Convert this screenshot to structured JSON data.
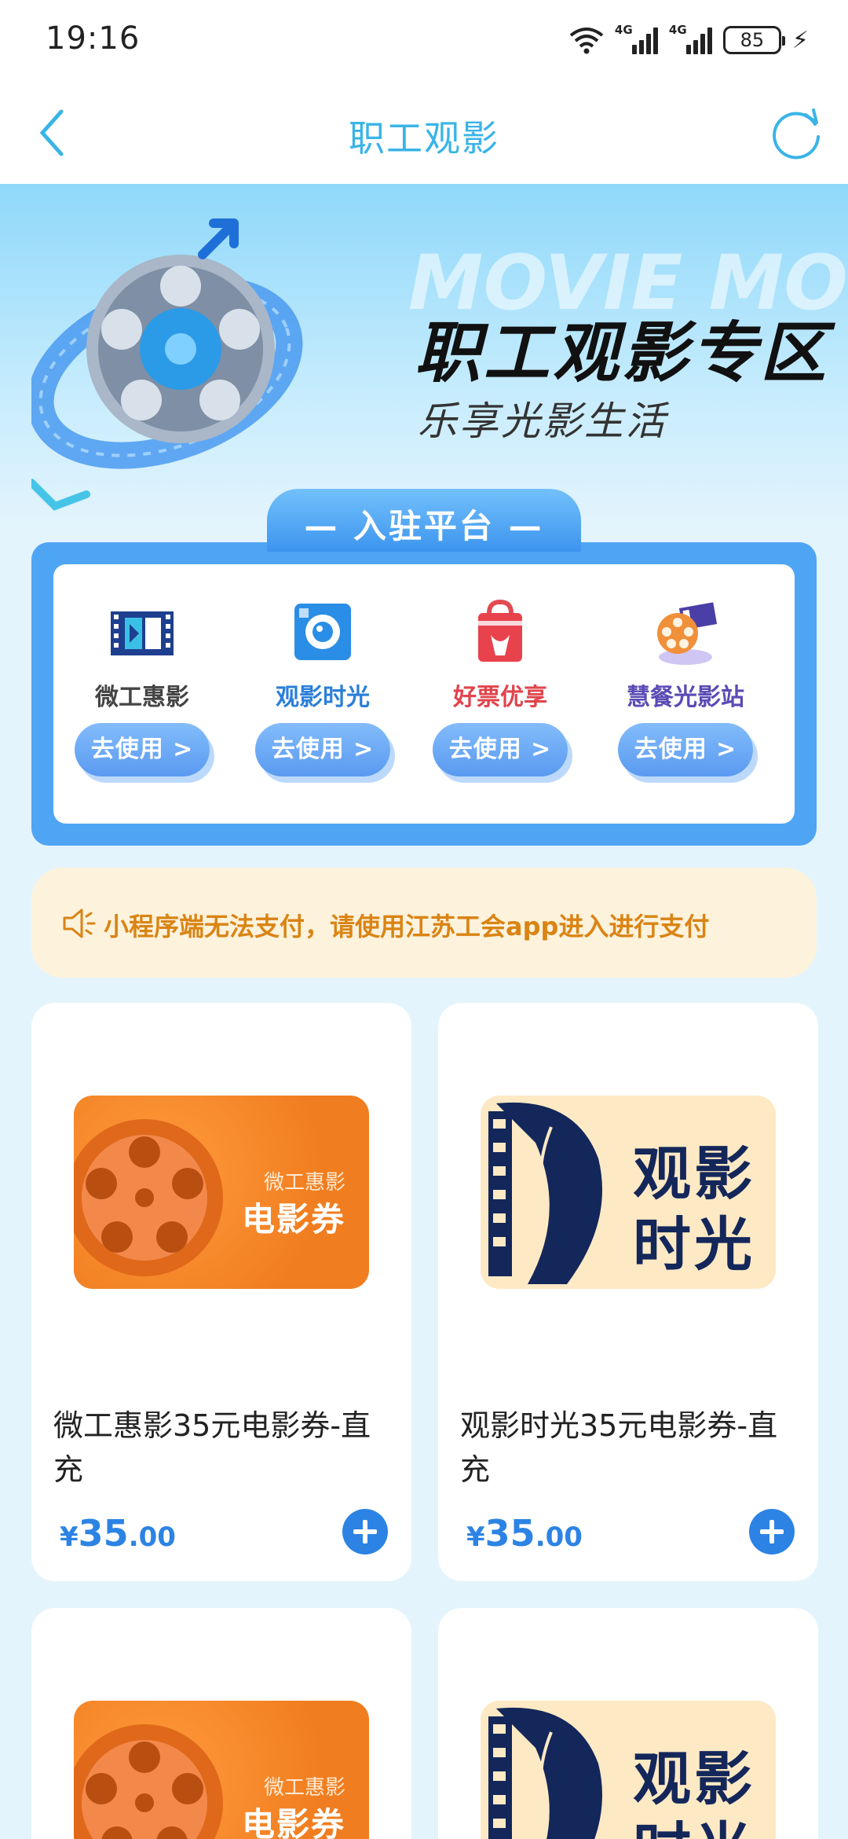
{
  "status_bar": {
    "time": "19:16",
    "network_1": "4G",
    "network_2": "4G",
    "battery": "85"
  },
  "nav": {
    "title": "职工观影"
  },
  "hero": {
    "watermark": "MOVIE MOVIE",
    "title": "职工观影专区",
    "subtitle": "乐享光影生活"
  },
  "platforms": {
    "header": "— 入驻平台 —",
    "items": [
      {
        "name": "微工惠影",
        "button": "去使用 >",
        "color": "#444444",
        "icon": "film-strip-icon"
      },
      {
        "name": "观影时光",
        "button": "去使用 >",
        "color": "#2b7fd8",
        "icon": "camera-icon"
      },
      {
        "name": "好票优享",
        "button": "去使用 >",
        "color": "#e0444c",
        "icon": "ticket-bag-icon"
      },
      {
        "name": "慧餐光影站",
        "button": "去使用 >",
        "color": "#5a4bb5",
        "icon": "film-reel-clapper-icon"
      }
    ]
  },
  "notice": {
    "text": "小程序端无法支付，请使用江苏工会app进入进行支付"
  },
  "products": [
    {
      "name": "微工惠影35元电影券-直充",
      "currency": "¥",
      "price_int": "35",
      "price_dec": ".00",
      "image_line1": "微工惠影",
      "image_line2": "电影券",
      "image_type": "orange"
    },
    {
      "name": "观影时光35元电影券-直充",
      "currency": "¥",
      "price_int": "35",
      "price_dec": ".00",
      "image_line1": "观影",
      "image_line2": "时光",
      "image_type": "beige"
    },
    {
      "image_line1": "微工惠影",
      "image_line2": "电影券",
      "image_type": "orange"
    },
    {
      "image_line1": "观影",
      "image_line2": "时光",
      "image_type": "beige"
    }
  ]
}
